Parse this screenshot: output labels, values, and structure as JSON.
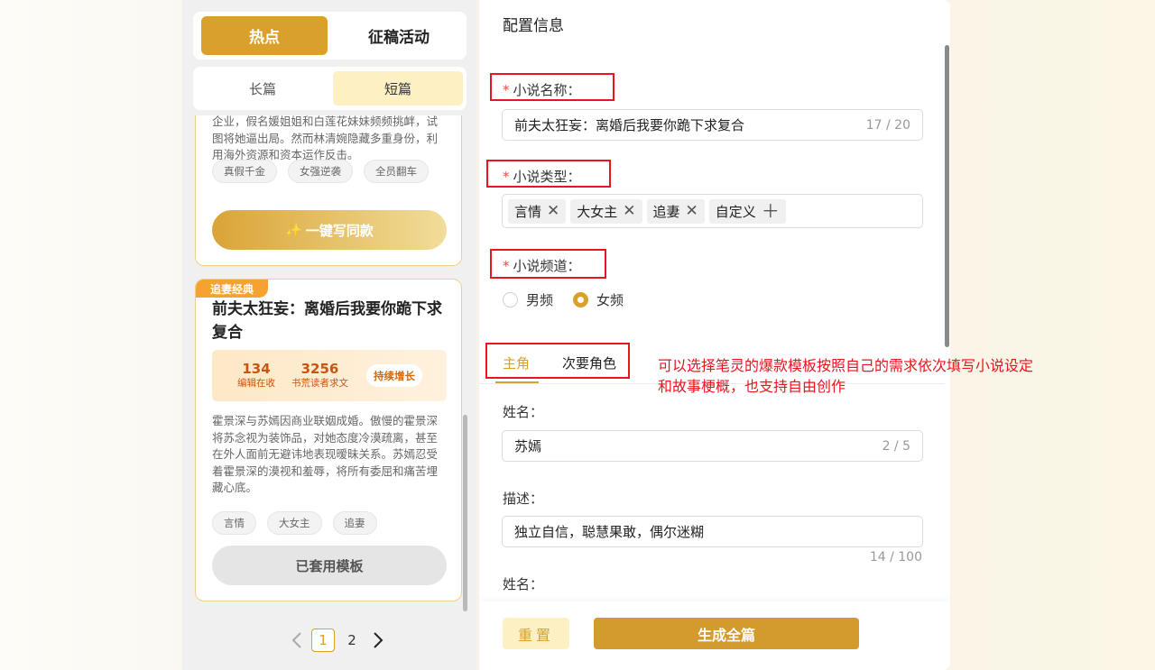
{
  "left": {
    "top_tabs": [
      "热点",
      "征稿活动"
    ],
    "sub_tabs": [
      "长篇",
      "短篇"
    ],
    "card1": {
      "desc": "企业，假名媛姐姐和白莲花妹妹频频挑衅，试图将她逼出局。然而林清婉隐藏多重身份，利用海外资源和资本运作反击。",
      "tags": [
        "真假千金",
        "女强逆袭",
        "全员翻车"
      ],
      "button": "一键写同款"
    },
    "card2": {
      "badge": "追妻经典",
      "title": "前夫太狂妄：离婚后我要你跪下求复合",
      "stat1_num": "134",
      "stat1_label": "编辑在收",
      "stat2_num": "3256",
      "stat2_label": "书荒读者求文",
      "growth": "持续增长",
      "desc": "霍景深与苏嫣因商业联姻成婚。傲慢的霍景深将苏念视为装饰品，对她态度冷漠疏离，甚至在外人面前无避讳地表现暧昧关系。苏嫣忍受着霍景深的漠视和羞辱，将所有委屈和痛苦埋藏心底。",
      "tags": [
        "言情",
        "大女主",
        "追妻"
      ],
      "button": "已套用模板"
    },
    "pager": {
      "pages": [
        "1",
        "2"
      ],
      "current": "1"
    }
  },
  "right": {
    "title": "配置信息",
    "name_label": "小说名称：",
    "name_value": "前夫太狂妄：离婚后我要你跪下求复合",
    "name_count": "17 / 20",
    "type_label": "小说类型：",
    "type_tags": [
      "言情",
      "大女主",
      "追妻"
    ],
    "custom_tag": "自定义",
    "channel_label": "小说频道：",
    "channel_options": [
      "男频",
      "女频"
    ],
    "channel_selected": "女频",
    "role_tabs": [
      "主角",
      "次要角色"
    ],
    "role_name_label": "姓名：",
    "role_name_value": "苏嫣",
    "role_name_count": "2 / 5",
    "role_desc_label": "描述：",
    "role_desc_value": "独立自信，聪慧果敢，偶尔迷糊",
    "role_desc_count": "14 / 100",
    "role2_name_label": "姓名：",
    "reset_button": "重置",
    "generate_button": "生成全篇"
  },
  "annotation": "可以选择笔灵的爆款模板按照自己的需求依次填写小说设定和故事梗概，也支持自由创作",
  "colors": {
    "accent": "#d9a12b",
    "annotation": "#e8141e"
  }
}
